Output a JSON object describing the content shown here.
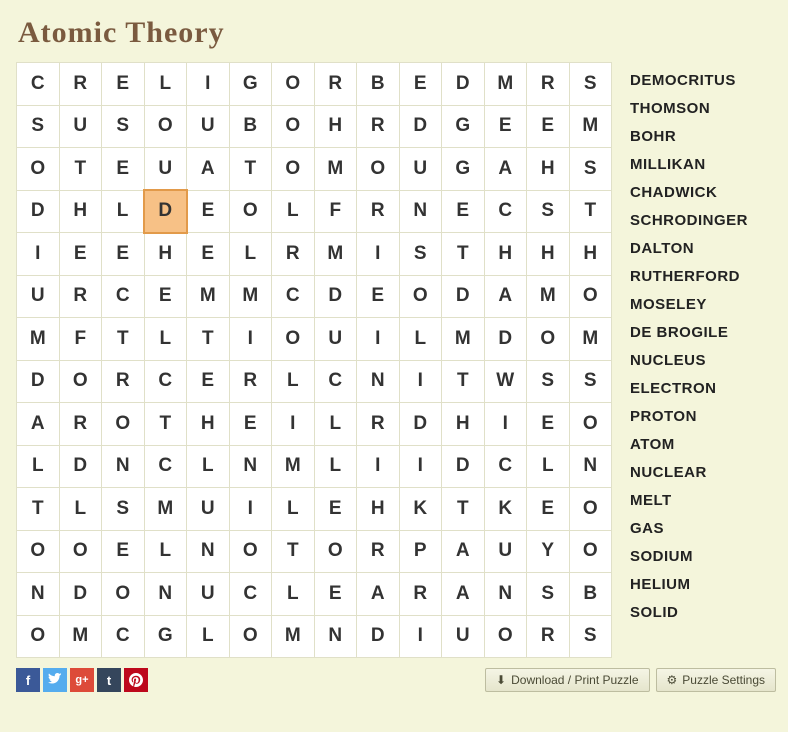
{
  "title": "Atomic Theory",
  "grid": [
    [
      "C",
      "R",
      "E",
      "L",
      "I",
      "G",
      "O",
      "R",
      "B",
      "E",
      "D",
      "M",
      "R",
      "S"
    ],
    [
      "S",
      "U",
      "S",
      "O",
      "U",
      "B",
      "O",
      "H",
      "R",
      "D",
      "G",
      "E",
      "E",
      "M"
    ],
    [
      "O",
      "T",
      "E",
      "U",
      "A",
      "T",
      "O",
      "M",
      "O",
      "U",
      "G",
      "A",
      "H",
      "S"
    ],
    [
      "D",
      "H",
      "L",
      "D",
      "E",
      "O",
      "L",
      "F",
      "R",
      "N",
      "E",
      "C",
      "S",
      "T"
    ],
    [
      "I",
      "E",
      "E",
      "H",
      "E",
      "L",
      "R",
      "M",
      "I",
      "S",
      "T",
      "H",
      "H",
      "H"
    ],
    [
      "U",
      "R",
      "C",
      "E",
      "M",
      "M",
      "C",
      "D",
      "E",
      "O",
      "D",
      "A",
      "M",
      "O"
    ],
    [
      "M",
      "F",
      "T",
      "L",
      "T",
      "I",
      "O",
      "U",
      "I",
      "L",
      "M",
      "D",
      "O",
      "M"
    ],
    [
      "D",
      "O",
      "R",
      "C",
      "E",
      "R",
      "L",
      "C",
      "N",
      "I",
      "T",
      "W",
      "S",
      "S"
    ],
    [
      "A",
      "R",
      "O",
      "T",
      "H",
      "E",
      "I",
      "L",
      "R",
      "D",
      "H",
      "I",
      "E",
      "O"
    ],
    [
      "L",
      "D",
      "N",
      "C",
      "L",
      "N",
      "M",
      "L",
      "I",
      "I",
      "D",
      "C",
      "L",
      "N"
    ],
    [
      "T",
      "L",
      "S",
      "M",
      "U",
      "I",
      "L",
      "E",
      "H",
      "K",
      "T",
      "K",
      "E",
      "O"
    ],
    [
      "O",
      "O",
      "E",
      "L",
      "N",
      "O",
      "T",
      "O",
      "R",
      "P",
      "A",
      "U",
      "Y",
      "O"
    ],
    [
      "N",
      "D",
      "O",
      "N",
      "U",
      "C",
      "L",
      "E",
      "A",
      "R",
      "A",
      "N",
      "S",
      "B"
    ],
    [
      "O",
      "M",
      "C",
      "G",
      "L",
      "O",
      "M",
      "N",
      "D",
      "I",
      "U",
      "O",
      "R",
      "S"
    ]
  ],
  "highlighted": {
    "row": 3,
    "col": 3
  },
  "words": [
    "DEMOCRITUS",
    "THOMSON",
    "BOHR",
    "MILLIKAN",
    "CHADWICK",
    "SCHRODINGER",
    "DALTON",
    "RUTHERFORD",
    "MOSELEY",
    "DE BROGILE",
    "NUCLEUS",
    "ELECTRON",
    "PROTON",
    "ATOM",
    "NUCLEAR",
    "MELT",
    "GAS",
    "SODIUM",
    "HELIUM",
    "SOLID"
  ],
  "buttons": {
    "download": "Download / Print Puzzle",
    "settings": "Puzzle Settings"
  },
  "social": {
    "fb": "f",
    "tw": "t",
    "gp": "g+",
    "tm": "t",
    "pn": "p"
  }
}
